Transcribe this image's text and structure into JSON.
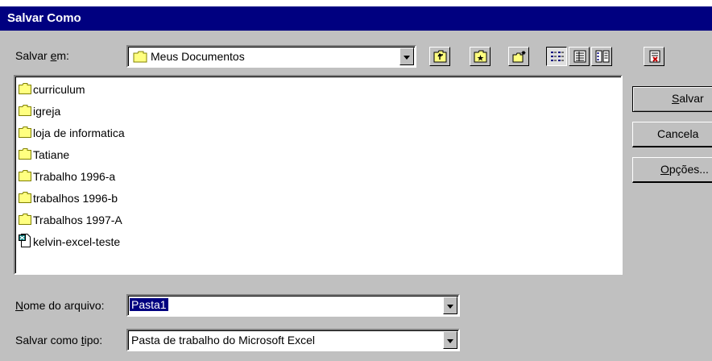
{
  "window": {
    "title": "Salvar Como"
  },
  "save_in": {
    "label_pre": "Salvar ",
    "label_u": "e",
    "label_post": "m:",
    "value": "Meus Documentos"
  },
  "toolbar": {
    "icons": [
      "up-one-level-icon",
      "look-in-favorites-icon",
      "create-new-folder-icon",
      "list-view-icon",
      "details-view-icon",
      "properties-view-icon",
      "commands-settings-icon"
    ]
  },
  "files": [
    {
      "name": "curriculum",
      "icon": "folder-icon"
    },
    {
      "name": "igreja",
      "icon": "folder-icon"
    },
    {
      "name": "loja de informatica",
      "icon": "folder-icon"
    },
    {
      "name": "Tatiane",
      "icon": "folder-icon"
    },
    {
      "name": "Trabalho 1996-a",
      "icon": "folder-icon"
    },
    {
      "name": "trabalhos 1996-b",
      "icon": "folder-icon"
    },
    {
      "name": "Trabalhos 1997-A",
      "icon": "folder-icon"
    },
    {
      "name": "kelvin-excel-teste",
      "icon": "excel-file-icon"
    }
  ],
  "buttons": {
    "save_u": "S",
    "save_rest": "alvar",
    "cancel": "Cancela",
    "options_u": "O",
    "options_rest": "pções..."
  },
  "filename": {
    "label_u": "N",
    "label_rest": "ome do arquivo:",
    "value": "Pasta1"
  },
  "filetype": {
    "label_pre": "Salvar como ",
    "label_u": "t",
    "label_post": "ipo:",
    "value": "Pasta de trabalho do Microsoft Excel"
  },
  "colors": {
    "title_bg": "#000080",
    "face": "#c0c0c0",
    "selection": "#000080",
    "folder": "#ffff80"
  }
}
